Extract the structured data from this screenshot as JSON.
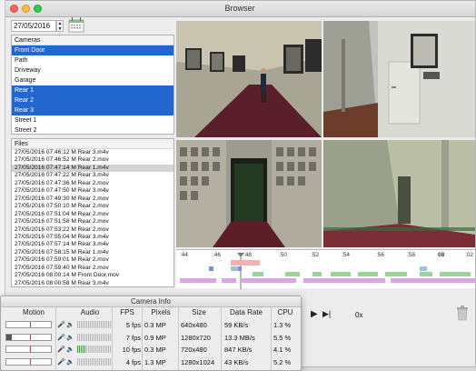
{
  "window": {
    "title": "Browser"
  },
  "colors": {
    "selection": "#2267cf",
    "traffic": [
      "#fc605c",
      "#fdbc40",
      "#34c84a"
    ]
  },
  "date": {
    "value": "27/05/2016"
  },
  "cameras": {
    "header": "Cameras",
    "items": [
      {
        "label": "Front Door",
        "selected": true
      },
      {
        "label": "Path",
        "selected": false
      },
      {
        "label": "Driveway",
        "selected": false
      },
      {
        "label": "Garage",
        "selected": false
      },
      {
        "label": "Rear 1",
        "selected": true
      },
      {
        "label": "Rear 2",
        "selected": true
      },
      {
        "label": "Rear 3",
        "selected": true
      },
      {
        "label": "Street 1",
        "selected": false
      },
      {
        "label": "Street 2",
        "selected": false
      }
    ]
  },
  "files": {
    "header": "Files",
    "items": [
      "27/05/2016 07:46:12 M Rear 3.m4v",
      "27/05/2016 07:46:52 M Rear 2.mov",
      "27/05/2016 07:47:14 M Rear 1.m4v",
      "27/05/2016 07:47:22 M Rear 3.m4v",
      "27/05/2016 07:47:36 M Rear 2.mov",
      "27/05/2016 07:47:50 M Rear 3.m4v",
      "27/05/2016 07:49:30 M Rear 2.mov",
      "27/05/2016 07:50:10 M Rear 2.mov",
      "27/05/2016 07:51:04 M Rear 2.mov",
      "27/05/2016 07:51:58 M Rear 2.mov",
      "27/05/2016 07:53:22 M Rear 2.mov",
      "27/05/2016 07:55:04 M Rear 3.m4v",
      "27/05/2016 07:57:14 M Rear 3.m4v",
      "27/05/2016 07:58:15 M Rear 1.m4v",
      "27/05/2016 07:59:01 M Rear 2.mov",
      "27/05/2016 07:59:40 M Rear 2.mov",
      "27/05/2016 08:00:14 M Front Door.mov",
      "27/05/2016 08:00:58 M Rear 3.m4v"
    ],
    "highlighted_index": 2
  },
  "timeline": {
    "ticks": [
      ":44",
      ":46",
      ":48",
      ":50",
      ":52",
      ":54",
      ":56",
      ":58",
      "08",
      ":02"
    ],
    "bold_tick": "08"
  },
  "playback": {
    "play": "▶",
    "next": "▶|",
    "speed": "0x"
  },
  "camera_info": {
    "title": "Camera Info",
    "columns": {
      "motion": "Motion",
      "audio": "Audio",
      "fps": "FPS",
      "pixels": "Pixels",
      "size": "Size",
      "datarate": "Data Rate",
      "cpu": "CPU"
    },
    "rows": [
      {
        "fps": "5 fps",
        "pixels": "0.3 MP",
        "size": "640x480",
        "datarate": "59 KB/s",
        "cpu": "1.3 %",
        "motion": 0.0,
        "audio": 0.0
      },
      {
        "fps": "7 fps",
        "pixels": "0.9 MP",
        "size": "1280x720",
        "datarate": "13.3 MB/s",
        "cpu": "5.5 %",
        "motion": 0.12,
        "audio": 0.0
      },
      {
        "fps": "10 fps",
        "pixels": "0.3 MP",
        "size": "720x480",
        "datarate": "847 KB/s",
        "cpu": "4.1 %",
        "motion": 0.0,
        "audio": 0.25
      },
      {
        "fps": "4 fps",
        "pixels": "1.3 MP",
        "size": "1280x1024",
        "datarate": "43 KB/s",
        "cpu": "5.2 %",
        "motion": 0.0,
        "audio": 0.0
      }
    ]
  }
}
